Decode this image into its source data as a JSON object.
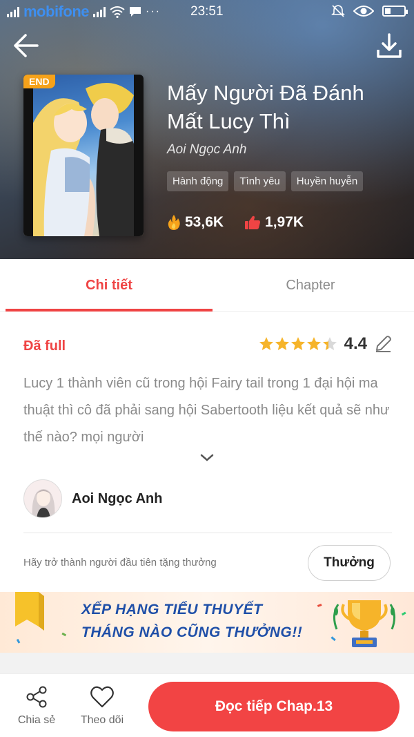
{
  "statusbar": {
    "carrier": "mobifone",
    "time": "23:51",
    "dots": "···"
  },
  "header": {
    "back_icon": "arrow-left-icon",
    "download_icon": "download-icon"
  },
  "story": {
    "badge": "END",
    "title": "Mấy Người Đã Đánh Mất Lucy Thì",
    "author": "Aoi Ngọc Anh",
    "tags": [
      "Hành động",
      "Tình yêu",
      "Huyền huyễn"
    ],
    "views": "53,6K",
    "likes": "1,97K"
  },
  "tabs": [
    {
      "label": "Chi tiết",
      "active": true
    },
    {
      "label": "Chapter",
      "active": false
    }
  ],
  "detail": {
    "status": "Đã full",
    "rating": "4.4",
    "rating_fraction": 0.88,
    "description": "Lucy 1 thành viên cũ trong hội Fairy tail trong 1 đại hội ma thuật thì cô đã phải sang hội Sabertooth liệu kết quả sẽ như thế nào? mọi người",
    "author_name": "Aoi Ngọc Anh",
    "reward_prompt": "Hãy trở thành người đầu tiên tặng thưởng",
    "reward_button": "Thưởng"
  },
  "banner": {
    "line1": "XẾP HẠNG TIỂU THUYẾT",
    "line2": "THÁNG NÀO CŨNG THƯỞNG!!"
  },
  "bottombar": {
    "share_label": "Chia sẻ",
    "follow_label": "Theo dõi",
    "read_button": "Đọc tiếp Chap.13"
  },
  "colors": {
    "accent": "#ef4444",
    "star": "#f6b42a",
    "banner_text": "#1f4fa8"
  }
}
